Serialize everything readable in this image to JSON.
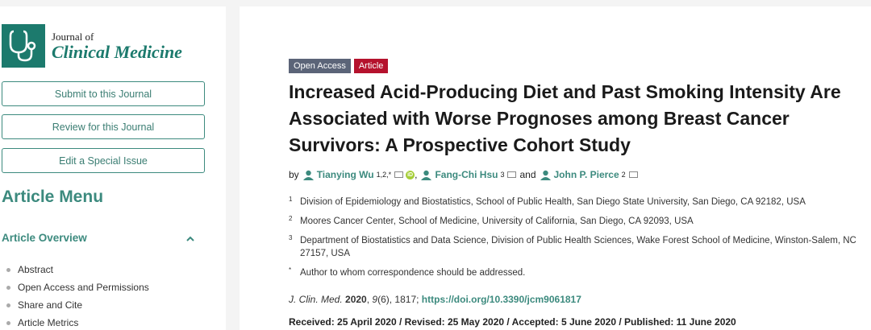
{
  "journal": {
    "line1": "Journal of",
    "line2": "Clinical Medicine",
    "brand_color": "#1c7a6d"
  },
  "sidebar": {
    "buttons": [
      "Submit to this Journal",
      "Review for this Journal",
      "Edit a Special Issue"
    ],
    "menu_title": "Article Menu",
    "overview_label": "Article Overview",
    "items": [
      "Abstract",
      "Open Access and Permissions",
      "Share and Cite",
      "Article Metrics"
    ]
  },
  "article": {
    "badges": [
      "Open Access",
      "Article"
    ],
    "title": "Increased Acid-Producing Diet and Past Smoking Intensity Are Associated with Worse Prognoses among Breast Cancer Survivors: A Prospective Cohort Study",
    "by": "by",
    "and": "and",
    "authors": [
      {
        "name": "Tianying Wu",
        "sup": "1,2,*"
      },
      {
        "name": "Fang-Chi Hsu",
        "sup": "3"
      },
      {
        "name": "John P. Pierce",
        "sup": "2"
      }
    ],
    "affiliations": [
      {
        "num": "1",
        "text": "Division of Epidemiology and Biostatistics, School of Public Health, San Diego State University, San Diego, CA 92182, USA"
      },
      {
        "num": "2",
        "text": "Moores Cancer Center, School of Medicine, University of California, San Diego, CA 92093, USA"
      },
      {
        "num": "3",
        "text": "Department of Biostatistics and Data Science, Division of Public Health Sciences, Wake Forest School of Medicine, Winston-Salem, NC 27157, USA"
      },
      {
        "num": "*",
        "text": "Author to whom correspondence should be addressed."
      }
    ],
    "citation": {
      "journal_abbr": "J. Clin. Med.",
      "year": "2020",
      "volume": "9",
      "issue": "(6)",
      "pages": ", 1817; ",
      "doi": "https://doi.org/10.3390/jcm9061817"
    },
    "dates": "Received: 25 April 2020 / Revised: 25 May 2020 / Accepted: 5 June 2020 / Published: 11 June 2020"
  },
  "icons": [
    "stethoscope-logo-icon",
    "author-profile-icon",
    "email-icon",
    "orcid-icon",
    "chevron-up-icon"
  ]
}
